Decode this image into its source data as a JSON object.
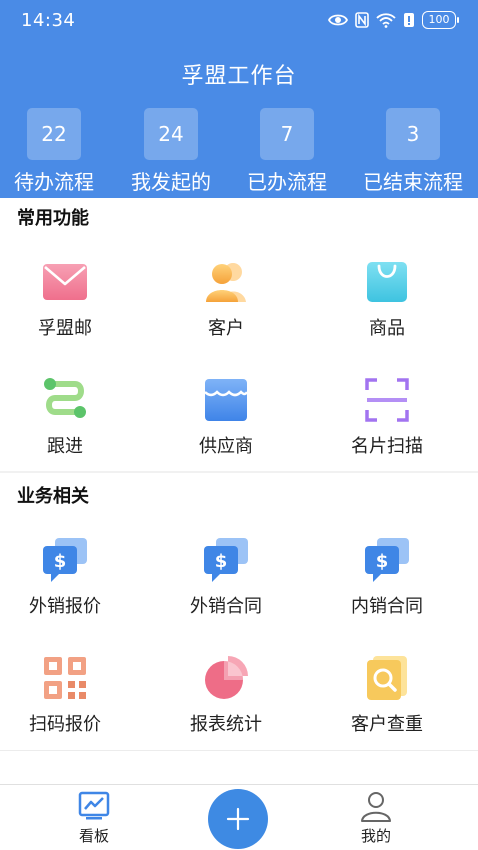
{
  "status_bar": {
    "time": "14:34",
    "battery": "100"
  },
  "header": {
    "title": "孚盟工作台"
  },
  "stats": [
    {
      "count": "22",
      "label": "待办流程"
    },
    {
      "count": "24",
      "label": "我发起的"
    },
    {
      "count": "7",
      "label": "已办流程"
    },
    {
      "count": "3",
      "label": "已结束流程"
    }
  ],
  "common": {
    "title": "常用功能",
    "items": [
      {
        "label": "孚盟邮",
        "icon": "mail-icon"
      },
      {
        "label": "客户",
        "icon": "customer-icon"
      },
      {
        "label": "商品",
        "icon": "shopping-bag-icon"
      },
      {
        "label": "跟进",
        "icon": "follow-up-icon"
      },
      {
        "label": "供应商",
        "icon": "store-icon"
      },
      {
        "label": "名片扫描",
        "icon": "scan-icon"
      }
    ]
  },
  "business": {
    "title": "业务相关",
    "items": [
      {
        "label": "外销报价",
        "icon": "quote-icon"
      },
      {
        "label": "外销合同",
        "icon": "contract-icon"
      },
      {
        "label": "内销合同",
        "icon": "contract-icon"
      },
      {
        "label": "扫码报价",
        "icon": "qr-code-icon"
      },
      {
        "label": "报表统计",
        "icon": "pie-chart-icon"
      },
      {
        "label": "客户查重",
        "icon": "search-document-icon"
      }
    ]
  },
  "tabbar": {
    "dashboard_label": "看板",
    "mine_label": "我的"
  },
  "colors": {
    "header": "#4a8be6",
    "fab": "#3e8ae3"
  }
}
